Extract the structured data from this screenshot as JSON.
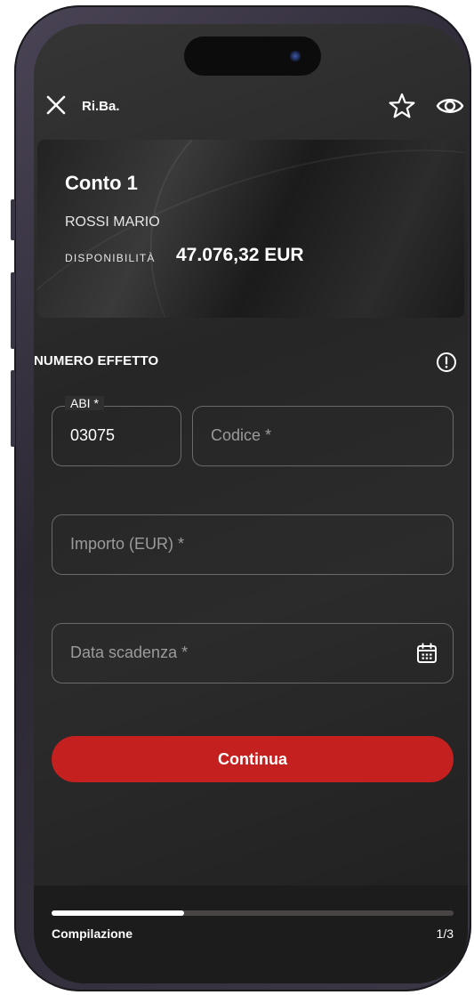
{
  "header": {
    "title": "Ri.Ba."
  },
  "account": {
    "name": "Conto 1",
    "owner": "ROSSI MARIO",
    "availability_label": "DISPONIBILITÀ",
    "availability_value": "47.076,32 EUR"
  },
  "form": {
    "section_title": "NUMERO EFFETTO",
    "abi": {
      "label": "ABI *",
      "value": "03075"
    },
    "codice": {
      "placeholder": "Codice *"
    },
    "importo": {
      "placeholder": "Importo (EUR) *"
    },
    "data_scadenza": {
      "placeholder": "Data scadenza *"
    },
    "continue_label": "Continua"
  },
  "progress": {
    "label": "Compilazione",
    "step": "1/3",
    "fraction": 0.33
  },
  "colors": {
    "accent_red": "#c4201f",
    "background": "#262626",
    "text": "#ffffff"
  },
  "icons": [
    "close-icon",
    "star-icon",
    "eye-icon",
    "info-icon",
    "calendar-icon"
  ]
}
